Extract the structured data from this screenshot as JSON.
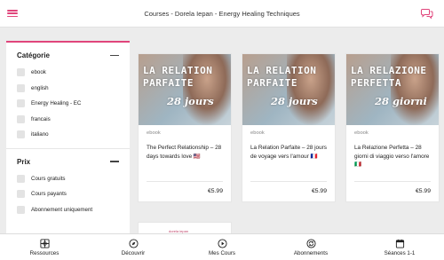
{
  "header": {
    "title": "Courses - Dorela Iepan - Energy Healing Techniques",
    "menu_icon": "hamburger-menu-icon",
    "chat_icon": "chat-bubbles-icon",
    "accent_color": "#e0457b"
  },
  "filters": [
    {
      "title": "Catégorie",
      "options": [
        "ebook",
        "english",
        "Energy Healing - EC",
        "francais",
        "italiano"
      ]
    },
    {
      "title": "Prix",
      "options": [
        "Cours gratuits",
        "Cours payants",
        "Abonnement uniquement"
      ]
    }
  ],
  "courses": [
    {
      "cover_line1": "LA RELATION",
      "cover_line2": "PARFAITE",
      "cover_line3": "28 jours",
      "type": "ebook",
      "title": "The Perfect Relationship – 28 days towards love 🇺🇸",
      "price": "€5.99"
    },
    {
      "cover_line1": "LA RELATION",
      "cover_line2": "PARFAITE",
      "cover_line3": "28 jours",
      "type": "ebook",
      "title": "La Relation Parfaite – 28 jours de voyage vers l'amour 🇫🇷",
      "price": "€5.99"
    },
    {
      "cover_line1": "LA RELAZIONE",
      "cover_line2": "PERFETTA",
      "cover_line3": "28 giorni",
      "type": "ebook",
      "title": "La Relazione Perfetta – 28 giorni di viaggio verso l'amore 🇮🇹",
      "price": "€5.99"
    }
  ],
  "partial_card": {
    "logo_text": "dorela iepan"
  },
  "bottom_nav": [
    {
      "label": "Ressources",
      "icon": "resources-icon"
    },
    {
      "label": "Découvrir",
      "icon": "compass-icon"
    },
    {
      "label": "Mes Cours",
      "icon": "play-circle-icon"
    },
    {
      "label": "Abonnements",
      "icon": "refresh-icon"
    },
    {
      "label": "Séances 1-1",
      "icon": "calendar-icon"
    }
  ]
}
